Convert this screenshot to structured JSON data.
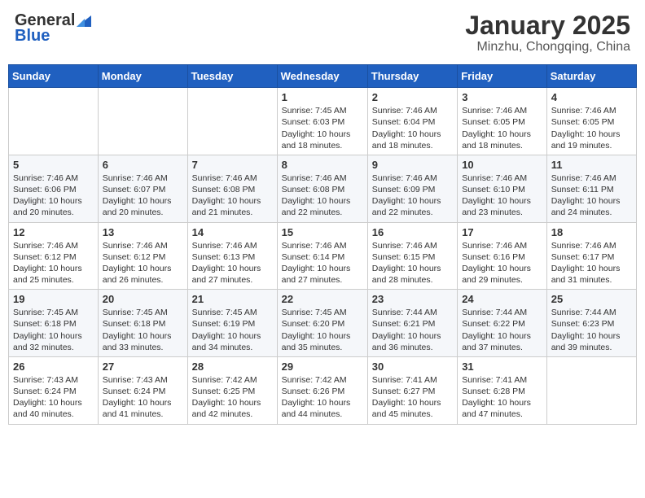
{
  "logo": {
    "general": "General",
    "blue": "Blue"
  },
  "title": "January 2025",
  "subtitle": "Minzhu, Chongqing, China",
  "days": [
    "Sunday",
    "Monday",
    "Tuesday",
    "Wednesday",
    "Thursday",
    "Friday",
    "Saturday"
  ],
  "weeks": [
    [
      {
        "date": "",
        "info": ""
      },
      {
        "date": "",
        "info": ""
      },
      {
        "date": "",
        "info": ""
      },
      {
        "date": "1",
        "info": "Sunrise: 7:45 AM\nSunset: 6:03 PM\nDaylight: 10 hours and 18 minutes."
      },
      {
        "date": "2",
        "info": "Sunrise: 7:46 AM\nSunset: 6:04 PM\nDaylight: 10 hours and 18 minutes."
      },
      {
        "date": "3",
        "info": "Sunrise: 7:46 AM\nSunset: 6:05 PM\nDaylight: 10 hours and 18 minutes."
      },
      {
        "date": "4",
        "info": "Sunrise: 7:46 AM\nSunset: 6:05 PM\nDaylight: 10 hours and 19 minutes."
      }
    ],
    [
      {
        "date": "5",
        "info": "Sunrise: 7:46 AM\nSunset: 6:06 PM\nDaylight: 10 hours and 20 minutes."
      },
      {
        "date": "6",
        "info": "Sunrise: 7:46 AM\nSunset: 6:07 PM\nDaylight: 10 hours and 20 minutes."
      },
      {
        "date": "7",
        "info": "Sunrise: 7:46 AM\nSunset: 6:08 PM\nDaylight: 10 hours and 21 minutes."
      },
      {
        "date": "8",
        "info": "Sunrise: 7:46 AM\nSunset: 6:08 PM\nDaylight: 10 hours and 22 minutes."
      },
      {
        "date": "9",
        "info": "Sunrise: 7:46 AM\nSunset: 6:09 PM\nDaylight: 10 hours and 22 minutes."
      },
      {
        "date": "10",
        "info": "Sunrise: 7:46 AM\nSunset: 6:10 PM\nDaylight: 10 hours and 23 minutes."
      },
      {
        "date": "11",
        "info": "Sunrise: 7:46 AM\nSunset: 6:11 PM\nDaylight: 10 hours and 24 minutes."
      }
    ],
    [
      {
        "date": "12",
        "info": "Sunrise: 7:46 AM\nSunset: 6:12 PM\nDaylight: 10 hours and 25 minutes."
      },
      {
        "date": "13",
        "info": "Sunrise: 7:46 AM\nSunset: 6:12 PM\nDaylight: 10 hours and 26 minutes."
      },
      {
        "date": "14",
        "info": "Sunrise: 7:46 AM\nSunset: 6:13 PM\nDaylight: 10 hours and 27 minutes."
      },
      {
        "date": "15",
        "info": "Sunrise: 7:46 AM\nSunset: 6:14 PM\nDaylight: 10 hours and 27 minutes."
      },
      {
        "date": "16",
        "info": "Sunrise: 7:46 AM\nSunset: 6:15 PM\nDaylight: 10 hours and 28 minutes."
      },
      {
        "date": "17",
        "info": "Sunrise: 7:46 AM\nSunset: 6:16 PM\nDaylight: 10 hours and 29 minutes."
      },
      {
        "date": "18",
        "info": "Sunrise: 7:46 AM\nSunset: 6:17 PM\nDaylight: 10 hours and 31 minutes."
      }
    ],
    [
      {
        "date": "19",
        "info": "Sunrise: 7:45 AM\nSunset: 6:18 PM\nDaylight: 10 hours and 32 minutes."
      },
      {
        "date": "20",
        "info": "Sunrise: 7:45 AM\nSunset: 6:18 PM\nDaylight: 10 hours and 33 minutes."
      },
      {
        "date": "21",
        "info": "Sunrise: 7:45 AM\nSunset: 6:19 PM\nDaylight: 10 hours and 34 minutes."
      },
      {
        "date": "22",
        "info": "Sunrise: 7:45 AM\nSunset: 6:20 PM\nDaylight: 10 hours and 35 minutes."
      },
      {
        "date": "23",
        "info": "Sunrise: 7:44 AM\nSunset: 6:21 PM\nDaylight: 10 hours and 36 minutes."
      },
      {
        "date": "24",
        "info": "Sunrise: 7:44 AM\nSunset: 6:22 PM\nDaylight: 10 hours and 37 minutes."
      },
      {
        "date": "25",
        "info": "Sunrise: 7:44 AM\nSunset: 6:23 PM\nDaylight: 10 hours and 39 minutes."
      }
    ],
    [
      {
        "date": "26",
        "info": "Sunrise: 7:43 AM\nSunset: 6:24 PM\nDaylight: 10 hours and 40 minutes."
      },
      {
        "date": "27",
        "info": "Sunrise: 7:43 AM\nSunset: 6:24 PM\nDaylight: 10 hours and 41 minutes."
      },
      {
        "date": "28",
        "info": "Sunrise: 7:42 AM\nSunset: 6:25 PM\nDaylight: 10 hours and 42 minutes."
      },
      {
        "date": "29",
        "info": "Sunrise: 7:42 AM\nSunset: 6:26 PM\nDaylight: 10 hours and 44 minutes."
      },
      {
        "date": "30",
        "info": "Sunrise: 7:41 AM\nSunset: 6:27 PM\nDaylight: 10 hours and 45 minutes."
      },
      {
        "date": "31",
        "info": "Sunrise: 7:41 AM\nSunset: 6:28 PM\nDaylight: 10 hours and 47 minutes."
      },
      {
        "date": "",
        "info": ""
      }
    ]
  ]
}
